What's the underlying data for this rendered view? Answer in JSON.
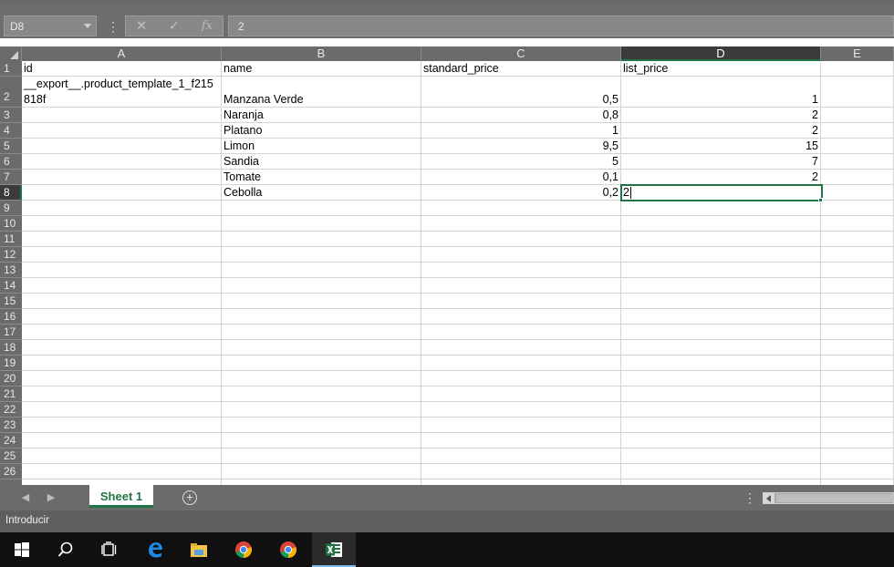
{
  "formula_bar": {
    "name_box": "D8",
    "more_icon": "vertical-dots-icon",
    "cancel_icon": "close-x-icon",
    "enter_icon": "checkmark-icon",
    "function_icon": "fx-icon",
    "formula_value": "2"
  },
  "columns": [
    {
      "label": "A"
    },
    {
      "label": "B"
    },
    {
      "label": "C"
    },
    {
      "label": "D"
    },
    {
      "label": "E"
    }
  ],
  "rows": [
    "1",
    "2",
    "3",
    "4",
    "5",
    "6",
    "7",
    "8",
    "9",
    "10",
    "11",
    "12",
    "13",
    "14",
    "15",
    "16",
    "17",
    "18",
    "19",
    "20",
    "21",
    "22",
    "23",
    "24",
    "25",
    "26"
  ],
  "cells": {
    "A1": "id",
    "B1": "name",
    "C1": "standard_price",
    "D1": "list_price",
    "A2_line1": "__export__.product_template_1_f215",
    "A2_line2": "818f",
    "B2": "Manzana Verde",
    "C2": "0,5",
    "D2": "1",
    "B3": "Naranja",
    "C3": "0,8",
    "D3": "2",
    "B4": "Platano",
    "C4": "1",
    "D4": "2",
    "B5": "Limon",
    "C5": "9,5",
    "D5": "15",
    "B6": "Sandia",
    "C6": "5",
    "D6": "7",
    "B7": "Tomate",
    "C7": "0,1",
    "D7": "2",
    "B8": "Cebolla",
    "C8": "0,2",
    "D8": "2"
  },
  "selection": {
    "active_column": "D",
    "active_row": "8"
  },
  "sheet_tabs": {
    "active_tab": "Sheet 1",
    "add_icon": "plus-circle-icon"
  },
  "status_bar": {
    "mode": "Introducir"
  },
  "taskbar": {
    "items": [
      {
        "icon": "windows-start-icon"
      },
      {
        "icon": "search-icon"
      },
      {
        "icon": "task-view-icon"
      },
      {
        "icon": "edge-browser-icon"
      },
      {
        "icon": "file-explorer-icon"
      },
      {
        "icon": "chrome-icon"
      },
      {
        "icon": "chrome-icon"
      },
      {
        "icon": "excel-icon"
      }
    ]
  },
  "colors": {
    "accent_green": "#217346",
    "ui_gray": "#6b6b6b",
    "taskbar": "#101010"
  }
}
